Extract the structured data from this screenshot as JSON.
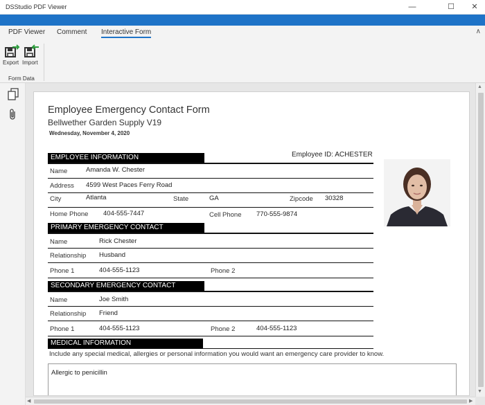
{
  "window": {
    "title": "DSStudio PDF Viewer",
    "controls": {
      "minimize": "—",
      "maximize": "☐",
      "close": "✕"
    }
  },
  "ribbon": {
    "tabs": [
      {
        "label": "PDF Viewer",
        "active": false
      },
      {
        "label": "Comment",
        "active": false
      },
      {
        "label": "Interactive Form",
        "active": true
      }
    ],
    "collapse_glyph": "∧",
    "buttons": [
      {
        "label": "Export",
        "icon": "export-icon"
      },
      {
        "label": "Import",
        "icon": "import-icon"
      }
    ],
    "group_label": "Form Data",
    "accent_color": "#1e73c7",
    "icon_color": "#2e9e3e"
  },
  "sidebar": {
    "icons": [
      "pages-icon",
      "attachment-icon"
    ]
  },
  "form": {
    "title": "Employee Emergency Contact Form",
    "subtitle": "Bellwether Garden Supply V19",
    "date": "Wednesday, November 4, 2020",
    "employee_id": "Employee ID: ACHESTER",
    "employee_info": {
      "heading": "EMPLOYEE INFORMATION",
      "name_label": "Name",
      "name": "Amanda W. Chester",
      "address_label": "Address",
      "address": "4599 West Paces Ferry Road",
      "city_label": "City",
      "city": "Atlanta",
      "state_label": "State",
      "state": "GA",
      "zip_label": "Zipcode",
      "zip": "30328",
      "home_phone_label": "Home Phone",
      "home_phone": "404-555-7447",
      "cell_phone_label": "Cell Phone",
      "cell_phone": "770-555-9874"
    },
    "primary_contact": {
      "heading": "PRIMARY EMERGENCY CONTACT",
      "name_label": "Name",
      "name": "Rick Chester",
      "relationship_label": "Relationship",
      "relationship": "Husband",
      "phone1_label": "Phone 1",
      "phone1": "404-555-1123",
      "phone2_label": "Phone 2",
      "phone2": ""
    },
    "secondary_contact": {
      "heading": "SECONDARY EMERGENCY CONTACT",
      "name_label": "Name",
      "name": "Joe Smith",
      "relationship_label": "Relationship",
      "relationship": "Friend",
      "phone1_label": "Phone 1",
      "phone1": "404-555-1123",
      "phone2_label": "Phone 2",
      "phone2": "404-555-1123"
    },
    "medical": {
      "heading": "MEDICAL INFORMATION",
      "note": "Include any special medical, allergies or personal information you would want an emergency care provider to know.",
      "text": "Allergic to penicillin"
    }
  }
}
